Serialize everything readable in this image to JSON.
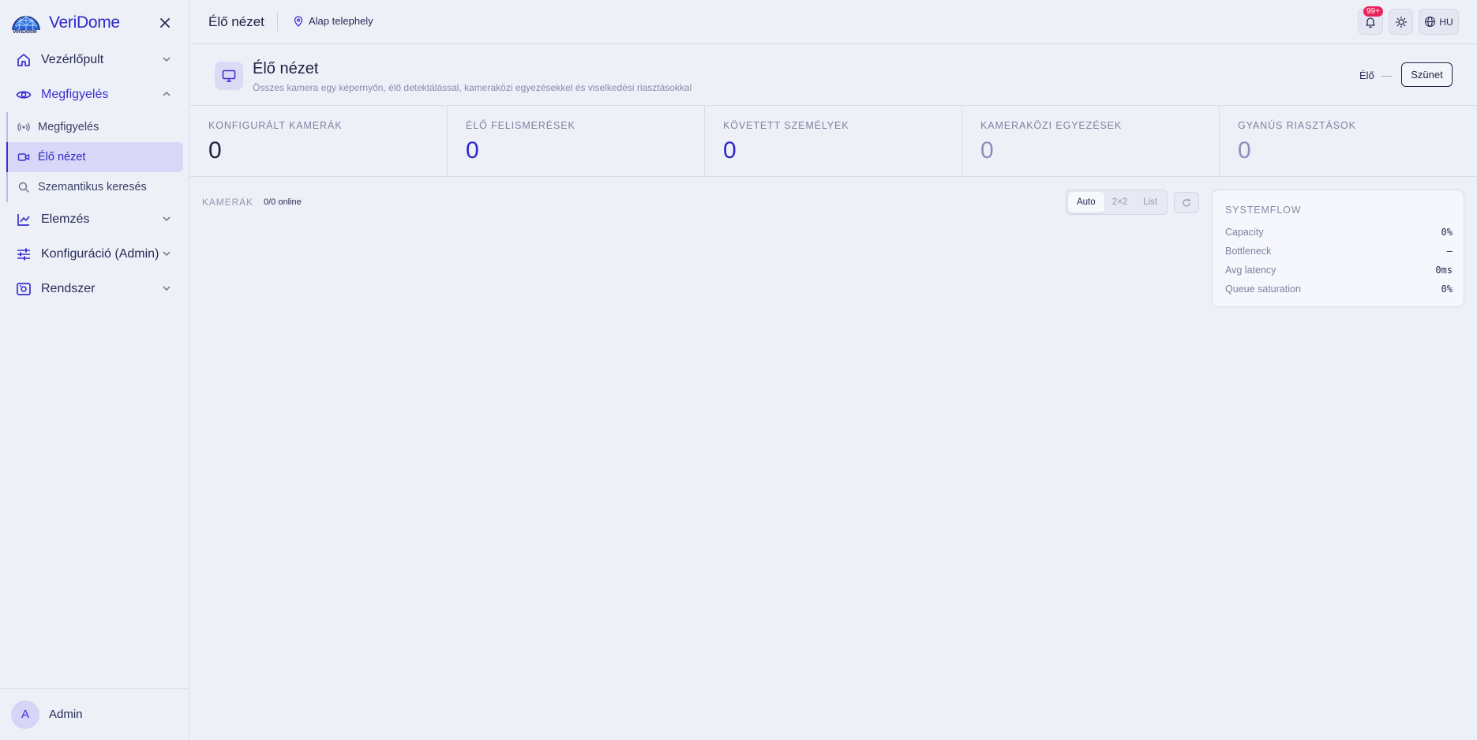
{
  "brand": {
    "name": "VeriDome",
    "logo_sub": "VeriDome"
  },
  "nav": {
    "dashboard": "Vezérlőpult",
    "monitoring": "Megfigyelés",
    "monitoring_items": [
      "Megfigyelés",
      "Élő nézet",
      "Szemantikus keresés"
    ],
    "analysis": "Elemzés",
    "config": "Konfiguráció (Admin)",
    "system": "Rendszer"
  },
  "user": {
    "initial": "A",
    "name": "Admin"
  },
  "topbar": {
    "title": "Élő nézet",
    "site": "Alap telephely",
    "notif_badge": "99+",
    "lang": "HU"
  },
  "page": {
    "title": "Élő nézet",
    "subtitle": "Összes kamera egy képernyőn, élő detektálással, kameraközi egyezésekkel és viselkedési riasztásokkal",
    "live_label": "Élő",
    "live_dash": "—",
    "pause_label": "Szünet"
  },
  "stats": [
    {
      "label": "Konfigurált kamerák",
      "value": "0",
      "color": "#1e2140"
    },
    {
      "label": "Élő felismerések",
      "value": "0",
      "color": "#2d28c7"
    },
    {
      "label": "Követett személyek",
      "value": "0",
      "color": "#2d28c7"
    },
    {
      "label": "Kameraközi egyezések",
      "value": "0",
      "color": "#8a90b8"
    },
    {
      "label": "Gyanús riasztások",
      "value": "0",
      "color": "#8a90b8"
    }
  ],
  "cameras": {
    "label": "KAMERÁK",
    "online": "0/0 online",
    "views": [
      "Auto",
      "2×2",
      "List"
    ],
    "selected_view": "Auto"
  },
  "systemflow": {
    "title": "SYSTEMFLOW",
    "rows": [
      {
        "key": "Capacity",
        "value": "0%"
      },
      {
        "key": "Bottleneck",
        "value": "—"
      },
      {
        "key": "Avg latency",
        "value": "0ms"
      },
      {
        "key": "Queue saturation",
        "value": "0%"
      }
    ]
  },
  "colors": {
    "accent": "#3a2fd0",
    "badge": "#e8245a",
    "background": "#eef0f8"
  }
}
